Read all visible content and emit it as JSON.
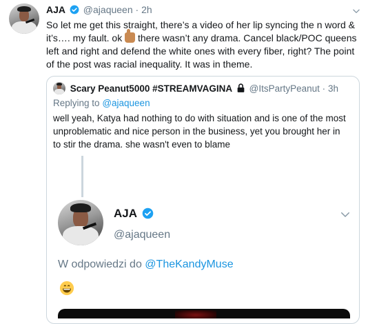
{
  "tweet": {
    "name": "AJA",
    "handle": "@ajaqueen",
    "sep": "·",
    "time": "2h",
    "text_part1": "So let me get this straight, there’s a video of her lip syncing the n word & it’s…. my fault. ok",
    "text_part2": "there wasn’t any drama. Cancel black/POC queens left and right and defend the white ones with every fiber, right? The point of the post was racial inequality. It was in theme.",
    "emoji": "thumbs-up-medium-skin"
  },
  "quote": {
    "name": "Scary Peanut5000 #STREAMVAGINA",
    "lock_icon": "lock-icon",
    "handle": "@ItsPartyPeanut",
    "sep": "·",
    "time": "3h",
    "replying_label": "Replying to",
    "replying_handle": "@ajaqueen",
    "text": "well yeah, Katya had nothing to do with situation and is one of the most unproblematic and nice person in the business, yet you brought her in to stir the drama. she wasn't even to blame"
  },
  "embedded": {
    "name": "AJA",
    "handle": "@ajaqueen",
    "reply_prefix": "W odpowiedzi do",
    "reply_handle": "@TheKandyMuse",
    "emoji": "grinning-face"
  },
  "colors": {
    "accent": "#1da1f2",
    "muted": "#657786",
    "border": "#ccd6dd"
  }
}
